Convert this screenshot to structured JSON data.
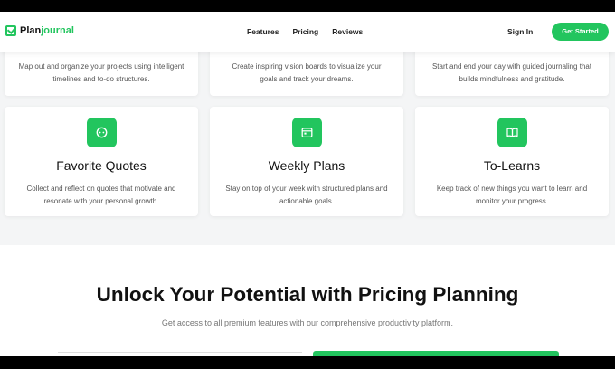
{
  "nav": {
    "logo_prefix": "Plan",
    "logo_accent": "journal",
    "links": [
      "Features",
      "Pricing",
      "Reviews"
    ],
    "sign_in": "Sign In",
    "get_started": "Get Started"
  },
  "top_cards": [
    {
      "desc": "Map out and organize your projects using intelligent timelines and to-do structures."
    },
    {
      "desc": "Create inspiring vision boards to visualize your goals and track your dreams."
    },
    {
      "desc": "Start and end your day with guided journaling that builds mindfulness and gratitude."
    }
  ],
  "cards": [
    {
      "icon": "quote-icon",
      "title": "Favorite Quotes",
      "desc": "Collect and reflect on quotes that motivate and resonate with your personal growth."
    },
    {
      "icon": "calendar-icon",
      "title": "Weekly Plans",
      "desc": "Stay on top of your week with structured plans and actionable goals."
    },
    {
      "icon": "book-icon",
      "title": "To-Learns",
      "desc": "Keep track of new things you want to learn and monitor your progress."
    }
  ],
  "pricing": {
    "title": "Unlock Your Potential with Pricing Planning",
    "subtitle": "Get access to all premium features with our comprehensive productivity platform."
  },
  "colors": {
    "accent": "#22c55e",
    "background": "#f4f5f6",
    "text": "#111111"
  }
}
